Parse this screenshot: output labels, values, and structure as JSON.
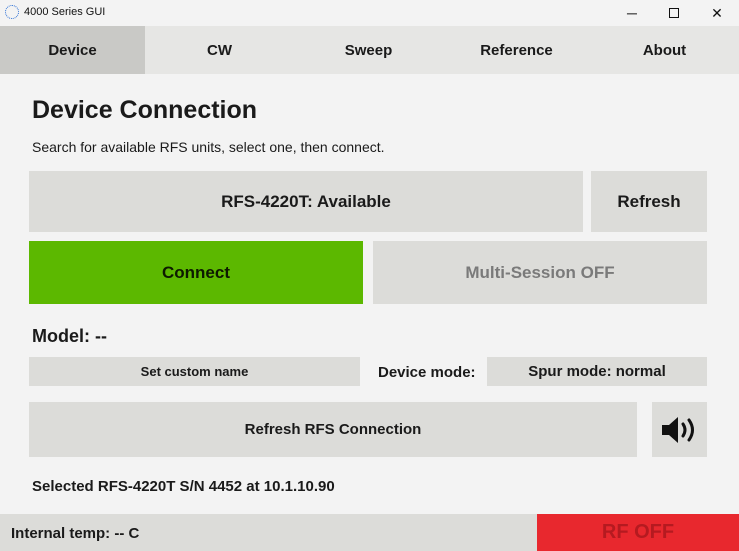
{
  "window": {
    "title": "4000 Series GUI",
    "minimize_label": "─",
    "close_label": "✕"
  },
  "tabs": [
    {
      "label": "Device",
      "active": true
    },
    {
      "label": "CW",
      "active": false
    },
    {
      "label": "Sweep",
      "active": false
    },
    {
      "label": "Reference",
      "active": false
    },
    {
      "label": "About",
      "active": false
    }
  ],
  "main": {
    "heading": "Device Connection",
    "subtext": "Search for available RFS units, select one, then connect.",
    "device_select_label": "RFS-4220T: Available",
    "refresh_label": "Refresh",
    "connect_label": "Connect",
    "multisession_label": "Multi-Session OFF",
    "model_label": "Model: --",
    "custom_name_label": "Set custom name",
    "device_mode_label": "Device mode:",
    "spur_mode_label": "Spur mode: normal",
    "refresh_connection_label": "Refresh RFS Connection",
    "sound_icon": "speaker-volume-icon",
    "selected_text": "Selected RFS-4220T S/N 4452 at 10.1.10.90"
  },
  "status": {
    "temp_text": "Internal temp: -- C",
    "rf_label": "RF OFF"
  },
  "colors": {
    "connect_green": "#5cb800",
    "rf_off_red": "#e8282e",
    "active_tab": "#c9c9c6",
    "button_gray": "#dcdcd9"
  }
}
